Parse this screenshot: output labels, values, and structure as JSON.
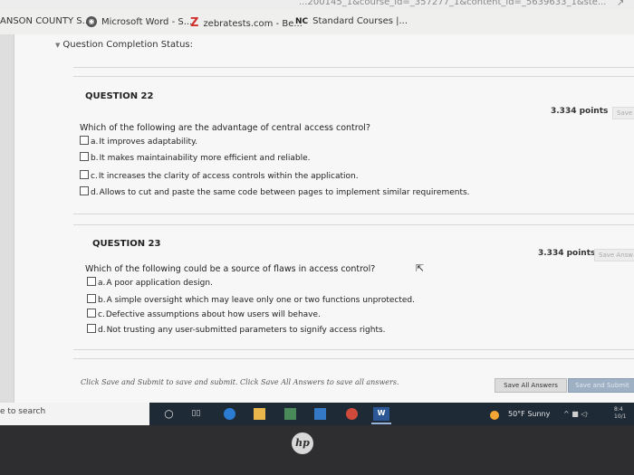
{
  "browser": {
    "url_fragment": "...200145_1&course_id=_357277_1&content_id=_5639633_1&ste...",
    "bookmarks": [
      {
        "label": "ANSON COUNTY S...",
        "icon": "folder-icon"
      },
      {
        "label": "Microsoft Word - S...",
        "icon": "globe-icon"
      },
      {
        "label": "zebratests.com - Be...",
        "icon": "zebratests-logo-icon",
        "glyph": "Z"
      },
      {
        "label": "Standard Courses |...",
        "icon": "nc-logo-icon",
        "glyph": "NC"
      }
    ]
  },
  "quiz": {
    "status_label": "Question Completion Status:",
    "questions": [
      {
        "heading": "QUESTION 22",
        "points": "3.334 points",
        "save_label": "Save",
        "text": "Which of the following are the advantage of central access control?",
        "options": [
          {
            "letter": "a.",
            "text": "It improves adaptability."
          },
          {
            "letter": "b.",
            "text": "It makes maintainability more efficient and reliable."
          },
          {
            "letter": "c.",
            "text": "It increases the clarity of access controls within the application."
          },
          {
            "letter": "d.",
            "text": "Allows to cut and paste the same code between pages to implement similar requirements."
          }
        ]
      },
      {
        "heading": "QUESTION 23",
        "points": "3.334 points",
        "save_label": "Save Answ",
        "text": "Which of the following could be a source of flaws in access control?",
        "options": [
          {
            "letter": "a.",
            "text": "A poor application design."
          },
          {
            "letter": "b.",
            "text": "A simple oversight which may leave only one or two functions unprotected."
          },
          {
            "letter": "c.",
            "text": "Defective assumptions about how users will behave."
          },
          {
            "letter": "d.",
            "text": "Not trusting any user-submitted parameters to signify access rights."
          }
        ]
      }
    ],
    "footer_note": "Click Save and Submit to save and submit. Click Save All Answers to save all answers.",
    "save_all_label": "Save All Answers",
    "save_submit_label": "Save and Submit"
  },
  "taskbar": {
    "search_text": "e to search",
    "word_icon_text": "W",
    "weather_text": "50°F  Sunny",
    "tray_text": "^ ■ ◁ᐧ",
    "clock_line1": "8:4",
    "clock_line2": "10/1"
  },
  "bezel": {
    "logo_text": "hp"
  },
  "colors": {
    "taskbar": "#1e2a36",
    "page": "#f7f7f7",
    "submit_button": "#9db0c4"
  }
}
